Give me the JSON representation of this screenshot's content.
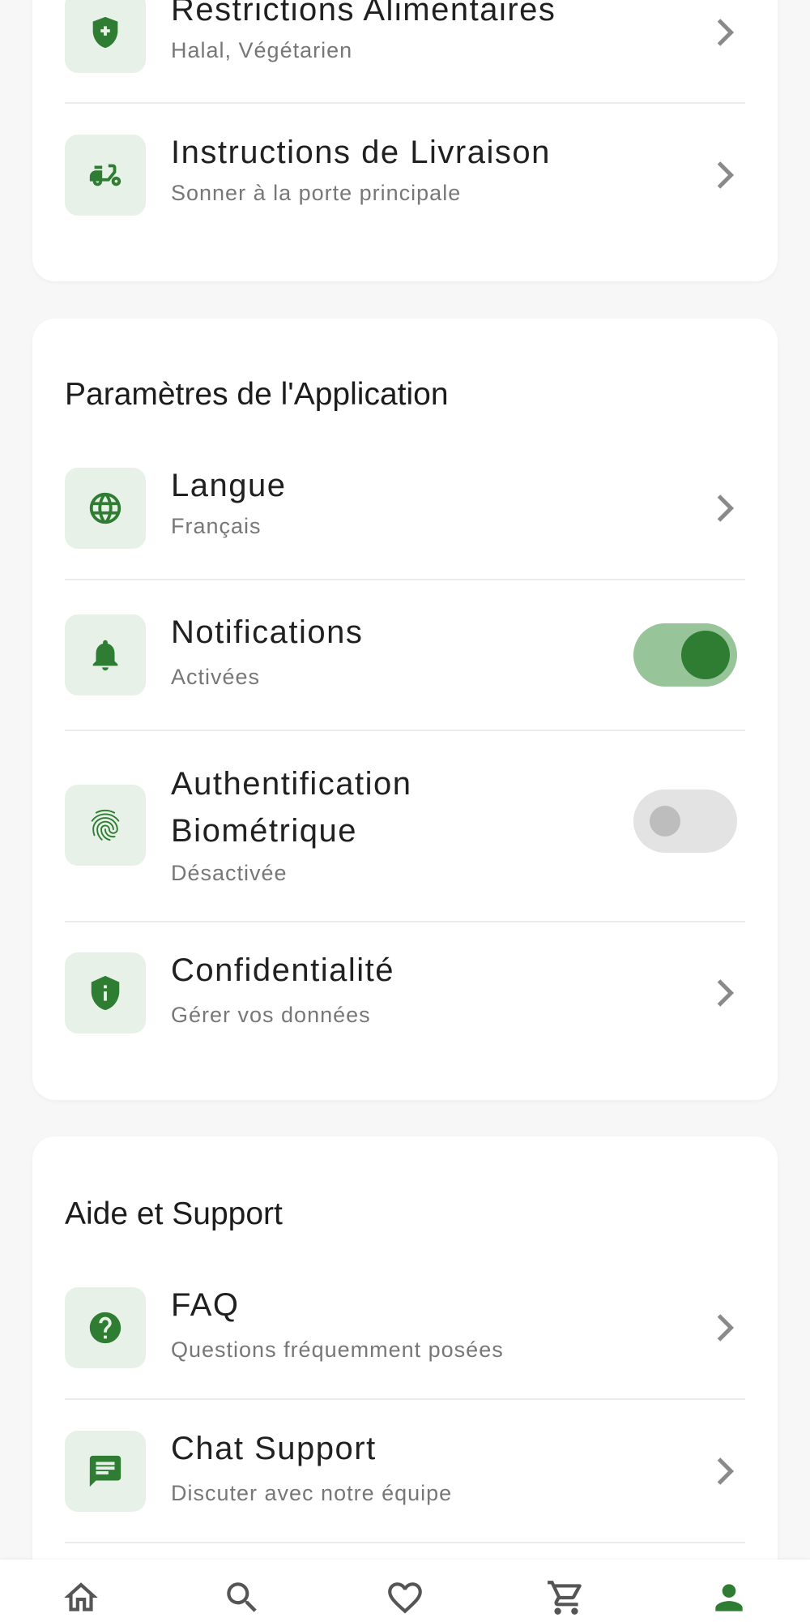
{
  "colors": {
    "accent": "#2e7d32",
    "icon_bg": "#e8f1e8",
    "toggle_on_track": "#97c499",
    "toggle_off_track": "#e3e3e3"
  },
  "card_profile": {
    "items": [
      {
        "title": "Restrictions Alimentaires",
        "subtitle": "Halal, Végétarien",
        "icon": "shield-plus-icon"
      },
      {
        "title": "Instructions de Livraison",
        "subtitle": "Sonner à la porte principale",
        "icon": "delivery-scooter-icon"
      }
    ]
  },
  "app_settings": {
    "title": "Paramètres de l'Application",
    "language": {
      "title": "Langue",
      "subtitle": "Français",
      "icon": "globe-icon"
    },
    "notifications": {
      "title": "Notifications",
      "subtitle": "Activées",
      "icon": "bell-icon",
      "enabled": true
    },
    "biometric": {
      "title_line1": "Authentification",
      "title_line2": "Biométrique",
      "subtitle": "Désactivée",
      "icon": "fingerprint-icon",
      "enabled": false
    },
    "privacy": {
      "title": "Confidentialité",
      "subtitle": "Gérer vos données",
      "icon": "shield-info-icon"
    }
  },
  "help": {
    "title": "Aide et Support",
    "items": [
      {
        "title": "FAQ",
        "subtitle": "Questions fréquemment posées",
        "icon": "help-circle-icon"
      },
      {
        "title": "Chat Support",
        "subtitle": "Discuter avec notre équipe",
        "icon": "chat-icon"
      }
    ]
  },
  "bottom_nav": {
    "items": [
      {
        "icon": "home-icon",
        "active": false
      },
      {
        "icon": "search-icon",
        "active": false
      },
      {
        "icon": "heart-icon",
        "active": false
      },
      {
        "icon": "cart-icon",
        "active": false
      },
      {
        "icon": "profile-icon",
        "active": true
      }
    ]
  }
}
